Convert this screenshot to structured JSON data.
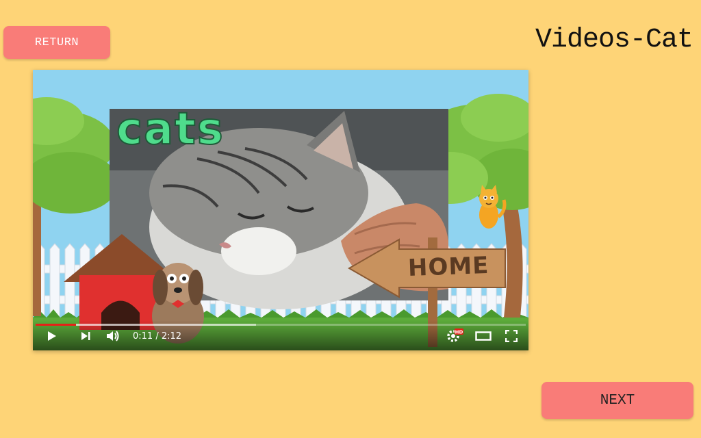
{
  "header": {
    "return_label": "RETURN",
    "title": "Videos-Cat"
  },
  "footer": {
    "next_label": "NEXT"
  },
  "video": {
    "overlay_word": "cats",
    "sign_label": "HOME",
    "current_time": "0:11",
    "duration": "2:12",
    "time_display": "0:11 / 2:12",
    "progress_fraction": 0.083,
    "buffered_fraction": 0.45,
    "hd_badge": "HD",
    "controls": [
      "play-icon",
      "next-icon",
      "volume-icon",
      "settings-icon",
      "theater-icon",
      "fullscreen-icon"
    ]
  },
  "colors": {
    "page_background": "#fed477",
    "button": "#f97c78",
    "progress": "#e62117",
    "overlay_word": "#4fdc8c"
  }
}
